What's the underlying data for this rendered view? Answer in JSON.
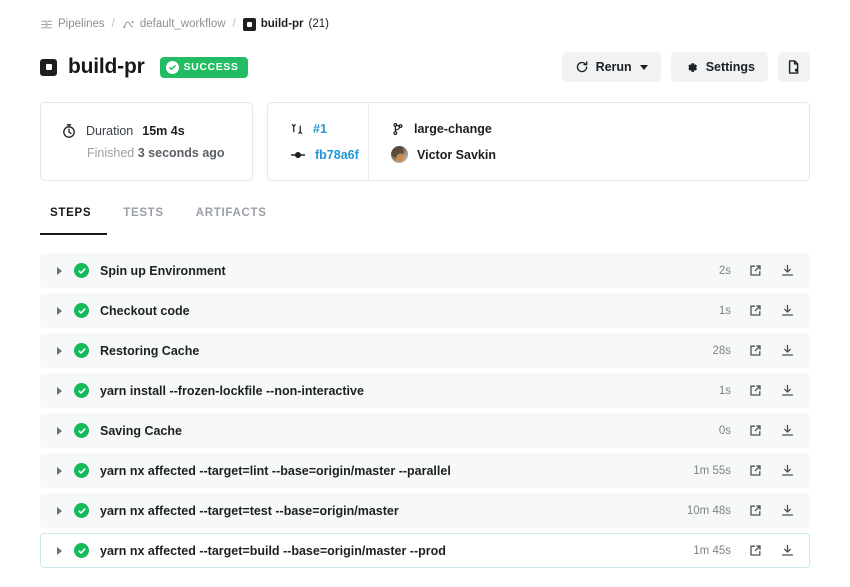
{
  "breadcrumb": {
    "items": [
      {
        "label": "Pipelines",
        "icon": "pipeline-icon"
      },
      {
        "label": "default_workflow",
        "icon": "workflow-icon"
      },
      {
        "label": "build-pr",
        "count": "(21)",
        "icon": "job-icon"
      }
    ],
    "separator": "/"
  },
  "header": {
    "title": "build-pr",
    "status_badge": "SUCCESS",
    "status_color": "#22bd62",
    "buttons": {
      "rerun": "Rerun",
      "settings": "Settings",
      "config": ""
    }
  },
  "summary": {
    "duration_label": "Duration",
    "duration_value": "15m 4s",
    "finished_label": "Finished",
    "finished_value": "3 seconds ago",
    "pull_request": "#1",
    "commit": "fb78a6f",
    "branch": "large-change",
    "author": "Victor Savkin",
    "link_color": "#2196d6"
  },
  "tabs": [
    {
      "label": "STEPS",
      "active": true
    },
    {
      "label": "TESTS",
      "active": false
    },
    {
      "label": "ARTIFACTS",
      "active": false
    }
  ],
  "steps": [
    {
      "label": "Spin up Environment",
      "duration": "2s",
      "status": "success",
      "selected": false
    },
    {
      "label": "Checkout code",
      "duration": "1s",
      "status": "success",
      "selected": false
    },
    {
      "label": "Restoring Cache",
      "duration": "28s",
      "status": "success",
      "selected": false
    },
    {
      "label": "yarn install --frozen-lockfile --non-interactive",
      "duration": "1s",
      "status": "success",
      "selected": false
    },
    {
      "label": "Saving Cache",
      "duration": "0s",
      "status": "success",
      "selected": false
    },
    {
      "label": "yarn nx affected --target=lint --base=origin/master --parallel",
      "duration": "1m 55s",
      "status": "success",
      "selected": false
    },
    {
      "label": "yarn nx affected --target=test --base=origin/master",
      "duration": "10m 48s",
      "status": "success",
      "selected": false
    },
    {
      "label": "yarn nx affected --target=build --base=origin/master --prod",
      "duration": "1m 45s",
      "status": "success",
      "selected": true
    }
  ],
  "step_actions": {
    "open_label": "open-in-new",
    "download_label": "download"
  }
}
